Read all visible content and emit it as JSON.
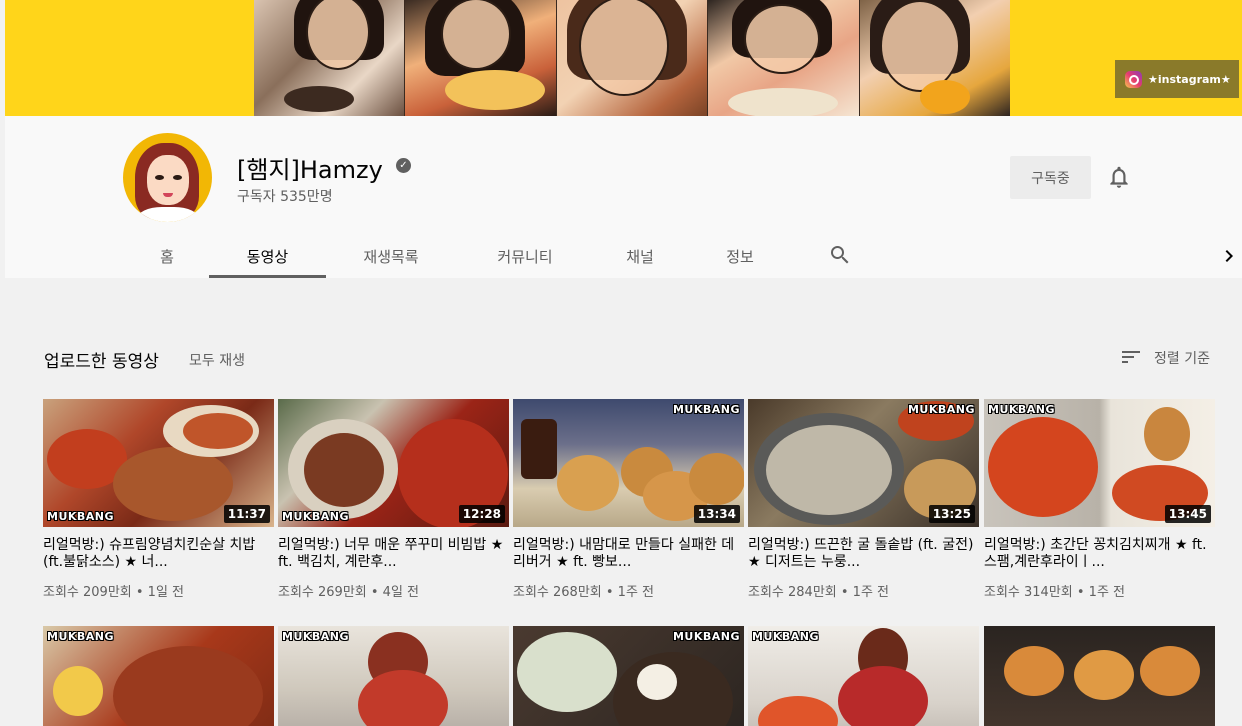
{
  "banner": {
    "instagram_label": "★instagram★"
  },
  "channel": {
    "name": "[햄지]Hamzy",
    "subscribers": "구독자 535만명",
    "subscribe_label": "구독중"
  },
  "tabs": [
    "홈",
    "동영상",
    "재생목록",
    "커뮤니티",
    "채널",
    "정보"
  ],
  "section": {
    "title": "업로드한 동영상",
    "play_all": "모두 재생",
    "sort_label": "정렬 기준"
  },
  "videos": [
    {
      "title": "리얼먹방:) 슈프림양념치킨순살 치밥 (ft.불닭소스) ★ 너...",
      "meta": "조회수 209만회 • 1일 전",
      "duration": "11:37",
      "tag": "MUKBANG"
    },
    {
      "title": "리얼먹방:) 너무 매운 쭈꾸미 비빔밥 ★ ft. 백김치, 계란후...",
      "meta": "조회수 269만회 • 4일 전",
      "duration": "12:28",
      "tag": "MUKBANG"
    },
    {
      "title": "리얼먹방:) 내맘대로 만들다 실패한 데리버거 ★ ft. 빵보...",
      "meta": "조회수 268만회 • 1주 전",
      "duration": "13:34",
      "tag": "MUKBANG"
    },
    {
      "title": "리얼먹방:) 뜨끈한 굴 돌솥밥 (ft. 굴전) ★ 디저트는 누룽...",
      "meta": "조회수 284만회 • 1주 전",
      "duration": "13:25",
      "tag": "MUKBANG"
    },
    {
      "title": "리얼먹방:) 초간단 꽁치김치찌개 ★ ft.스팸,계란후라이ㅣ...",
      "meta": "조회수 314만회 • 1주 전",
      "duration": "13:45",
      "tag": "MUKBANG"
    }
  ],
  "row2_tags": [
    "MUKBANG",
    "MUKBANG",
    "MUKBANG",
    "MUKBANG"
  ]
}
